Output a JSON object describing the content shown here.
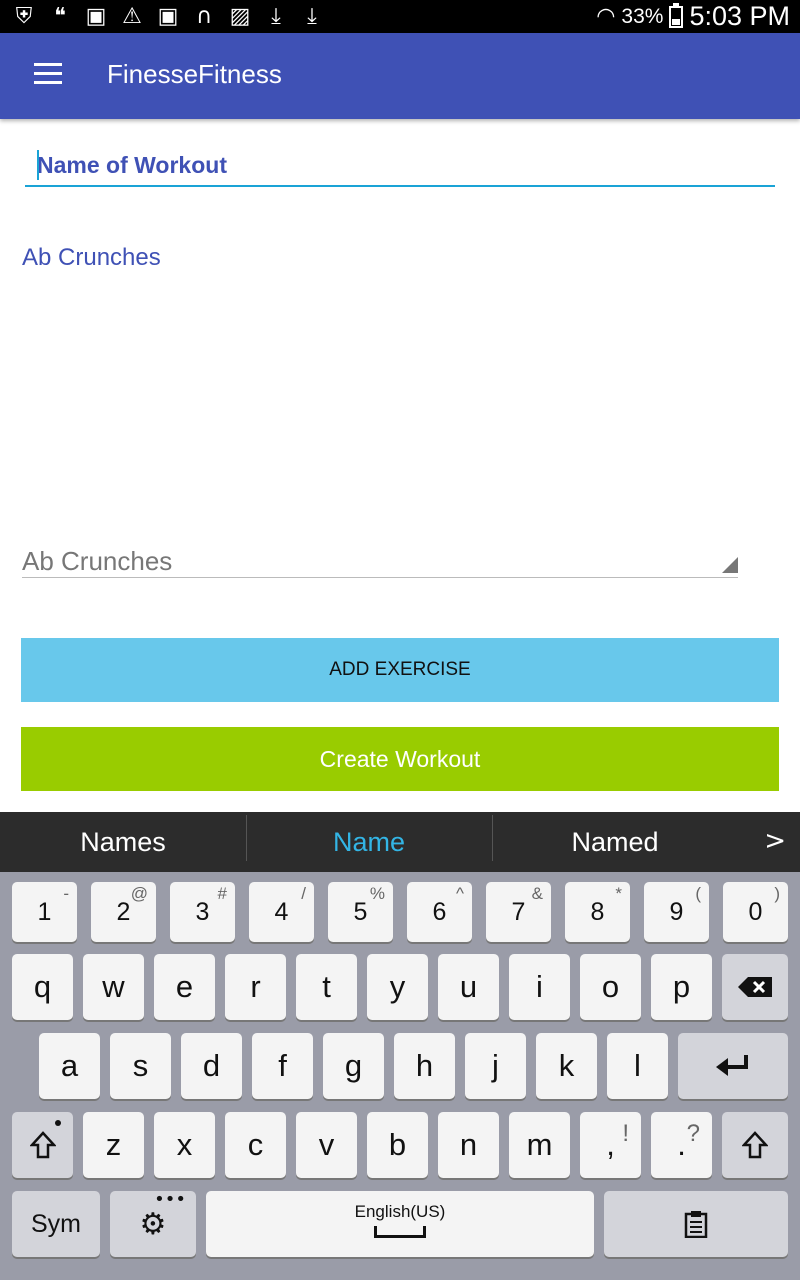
{
  "status_bar": {
    "left_icons": [
      "shield-icon",
      "hangouts-icon",
      "galaxy-icon",
      "warning-icon",
      "galaxy-icon",
      "headphones-icon",
      "gallery-icon",
      "download-icon",
      "download-icon"
    ],
    "battery": "33%",
    "time": "5:03 PM"
  },
  "app_bar": {
    "title": "FinesseFitness"
  },
  "form": {
    "name_placeholder": "Name of Workout",
    "exercise_list": [
      "Ab Crunches"
    ],
    "spinner_value": "Ab Crunches",
    "add_button": "ADD EXERCISE",
    "create_button": "Create Workout"
  },
  "colors": {
    "primary": "#3F51B5",
    "add_button": "#68C8EB",
    "create_button": "#99CC00",
    "accent": "#1aa3d6"
  },
  "keyboard": {
    "suggestions": [
      "Names",
      "Name",
      "Named"
    ],
    "more": ">",
    "number_row": [
      {
        "k": "1",
        "s": "-"
      },
      {
        "k": "2",
        "s": "@"
      },
      {
        "k": "3",
        "s": "#"
      },
      {
        "k": "4",
        "s": "/"
      },
      {
        "k": "5",
        "s": "%"
      },
      {
        "k": "6",
        "s": "^"
      },
      {
        "k": "7",
        "s": "&"
      },
      {
        "k": "8",
        "s": "*"
      },
      {
        "k": "9",
        "s": "("
      },
      {
        "k": "0",
        "s": ")"
      }
    ],
    "row1": [
      "q",
      "w",
      "e",
      "r",
      "t",
      "y",
      "u",
      "i",
      "o",
      "p"
    ],
    "row2": [
      "a",
      "s",
      "d",
      "f",
      "g",
      "h",
      "j",
      "k",
      "l"
    ],
    "row3": [
      "z",
      "x",
      "c",
      "v",
      "b",
      "n",
      "m"
    ],
    "comma": {
      "k": ",",
      "s": "!"
    },
    "period": {
      "k": ".",
      "s": "?"
    },
    "sym": "Sym",
    "space_label": "English(US)"
  }
}
